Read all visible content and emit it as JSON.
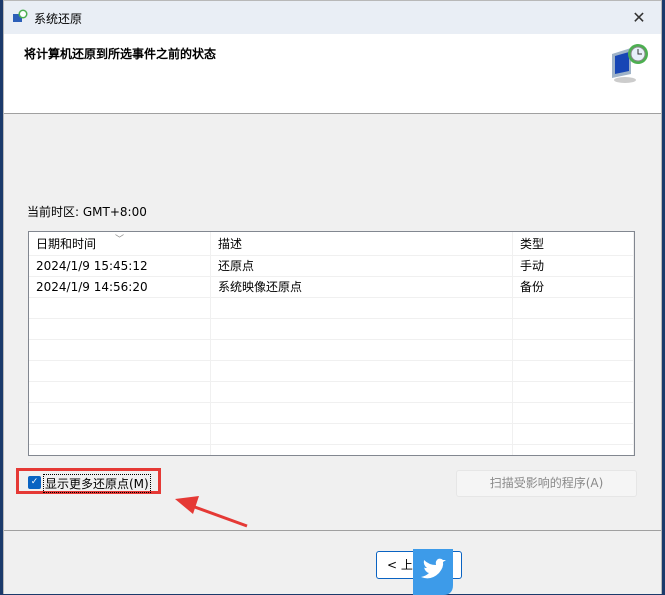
{
  "window": {
    "title": "系统还原",
    "close": "✕"
  },
  "header": {
    "heading": "将计算机还原到所选事件之前的状态"
  },
  "timezone": "当前时区: GMT+8:00",
  "table": {
    "columns": [
      "日期和时间",
      "描述",
      "类型"
    ],
    "rows": [
      {
        "date": "2024/1/9 15:45:12",
        "desc": "还原点",
        "type": "手动"
      },
      {
        "date": "2024/1/9 14:56:20",
        "desc": "系统映像还原点",
        "type": "备份"
      }
    ]
  },
  "show_more": {
    "label": "显示更多还原点(M)",
    "checked": true
  },
  "scan_button": "扫描受影响的程序(A)",
  "back_button": "< 上",
  "colors": {
    "accent": "#0a63c2",
    "annotation": "#e53935",
    "watermark": "#3d9be9"
  }
}
